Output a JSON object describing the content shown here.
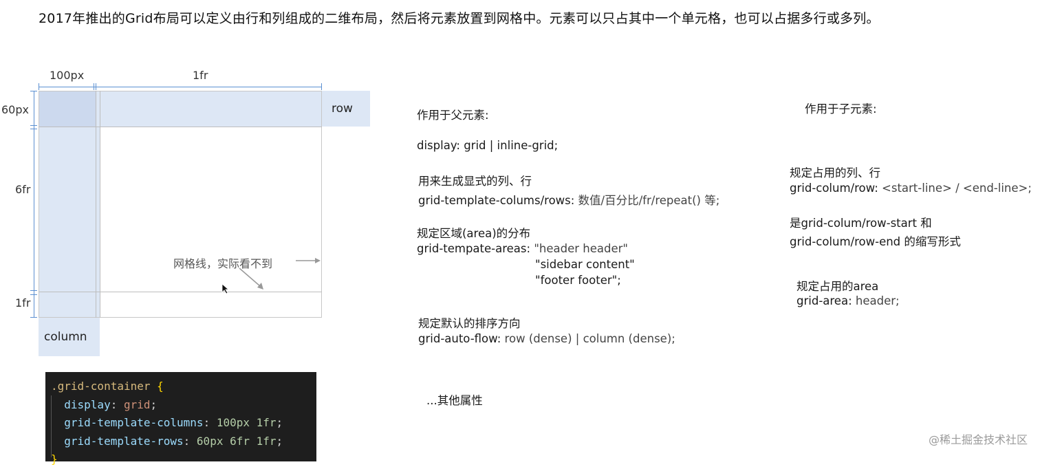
{
  "intro": "2017年推出的Grid布局可以定义由行和列组成的二维布局，然后将元素放置到网格中。元素可以只占其中一个单元格，也可以占据多行或多列。",
  "diagram": {
    "col_100px": "100px",
    "col_1fr": "1fr",
    "row_60px": "60px",
    "row_6fr": "6fr",
    "row_1fr": "1fr",
    "row_label": "row",
    "column_label": "column",
    "gridline_note": "网格线，实际看不到"
  },
  "code": {
    "line1_selector": ".grid-container",
    "line1_brace": " {",
    "line2_prop": "display",
    "line2_val": "grid",
    "line3_prop": "grid-template-columns",
    "line3_num1": "100px",
    "line3_num2": "1fr",
    "line4_prop": "grid-template-rows",
    "line4_num1": "60px",
    "line4_num2": "6fr",
    "line4_num3": "1fr",
    "line5_brace": "}"
  },
  "parent": {
    "heading": "作用于父元素:",
    "display_key": "display:",
    "display_val": " grid | inline-grid;",
    "explicit_heading": "用来生成显式的列、行",
    "template_key": "grid-template-colums/rows:",
    "template_val": " 数值/百分比/fr/repeat() 等;",
    "areas_heading": "规定区域(area)的分布",
    "areas_key": "grid-tempate-areas:",
    "areas_val1": "\"header header\"",
    "areas_val2": "\"sidebar content\"",
    "areas_val3": "\"footer footer\";",
    "flow_heading": "规定默认的排序方向",
    "flow_key": "grid-auto-flow:",
    "flow_val": " row (dense) | column (dense);",
    "others": "...其他属性"
  },
  "child": {
    "heading": "作用于子元素:",
    "span_heading": "规定占用的列、行",
    "span_key": "grid-colum/row:",
    "span_val": "  <start-line> / <end-line>;",
    "shorthand1": "是grid-colum/row-start 和",
    "shorthand2": "grid-colum/row-end 的缩写形式",
    "area_heading": "规定占用的area",
    "area_key": "grid-area:",
    "area_val": " header;"
  },
  "watermark": "@稀土掘金技术社区"
}
